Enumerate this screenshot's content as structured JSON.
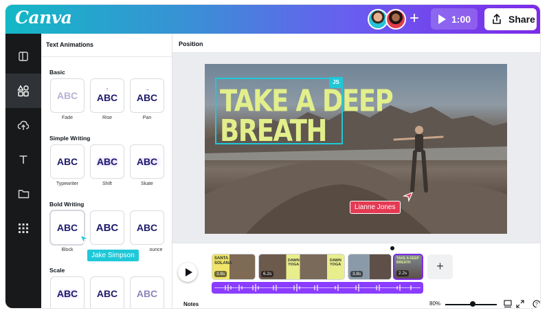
{
  "app": {
    "logo": "Canva",
    "play_duration": "1:00",
    "share_label": "Share",
    "brand_colors": {
      "teal": "#1fc8d8",
      "purple": "#7d2ae8",
      "red": "#e53a54",
      "headline": "#e2ef8a"
    }
  },
  "rail": {
    "items": [
      {
        "icon": "layout-icon"
      },
      {
        "icon": "elements-icon"
      },
      {
        "icon": "upload-icon"
      },
      {
        "icon": "text-icon"
      },
      {
        "icon": "folder-icon"
      },
      {
        "icon": "apps-grid-icon"
      }
    ]
  },
  "panel": {
    "title": "Text Animations",
    "sections": [
      {
        "label": "Basic",
        "tiles": [
          {
            "text": "ABC",
            "caption": "Fade"
          },
          {
            "text": "ABC",
            "caption": "Rise"
          },
          {
            "text": "ABC",
            "caption": "Pan"
          }
        ]
      },
      {
        "label": "Simple Writing",
        "tiles": [
          {
            "text": "ABC",
            "caption": "Typewriter"
          },
          {
            "text": "ABC",
            "caption": "Shift"
          },
          {
            "text": "ABC",
            "caption": "Skate"
          }
        ]
      },
      {
        "label": "Bold Writing",
        "tiles": [
          {
            "text": "ABC",
            "caption": "Block"
          },
          {
            "text": "ABC",
            "caption": ""
          },
          {
            "text": "ABC",
            "caption": "ounce"
          }
        ]
      },
      {
        "label": "Scale",
        "tiles": [
          {
            "text": "ABC",
            "caption": ""
          },
          {
            "text": "ABC",
            "caption": ""
          },
          {
            "text": "ABC",
            "caption": ""
          }
        ]
      }
    ]
  },
  "editor": {
    "header": "Position",
    "headline_line1": "TAKE A DEEP",
    "headline_line2": "BREATH",
    "selection_badge": "JS",
    "collaborator_red": "Lianne Jones",
    "collaborator_teal": "Jake Simpson"
  },
  "timeline": {
    "clips": [
      {
        "duration": "3.8s",
        "title": "SANTA SOLANA"
      },
      {
        "duration": "6.2s",
        "title": "DAWN YOGA"
      },
      {
        "duration": "3.8s",
        "title": ""
      },
      {
        "duration": "2.2s",
        "title": "TAKE A DEEP BREATH"
      }
    ],
    "add_clip": "+",
    "notes_label": "Notes",
    "zoom": "80%",
    "zoom_level": 0.55
  }
}
